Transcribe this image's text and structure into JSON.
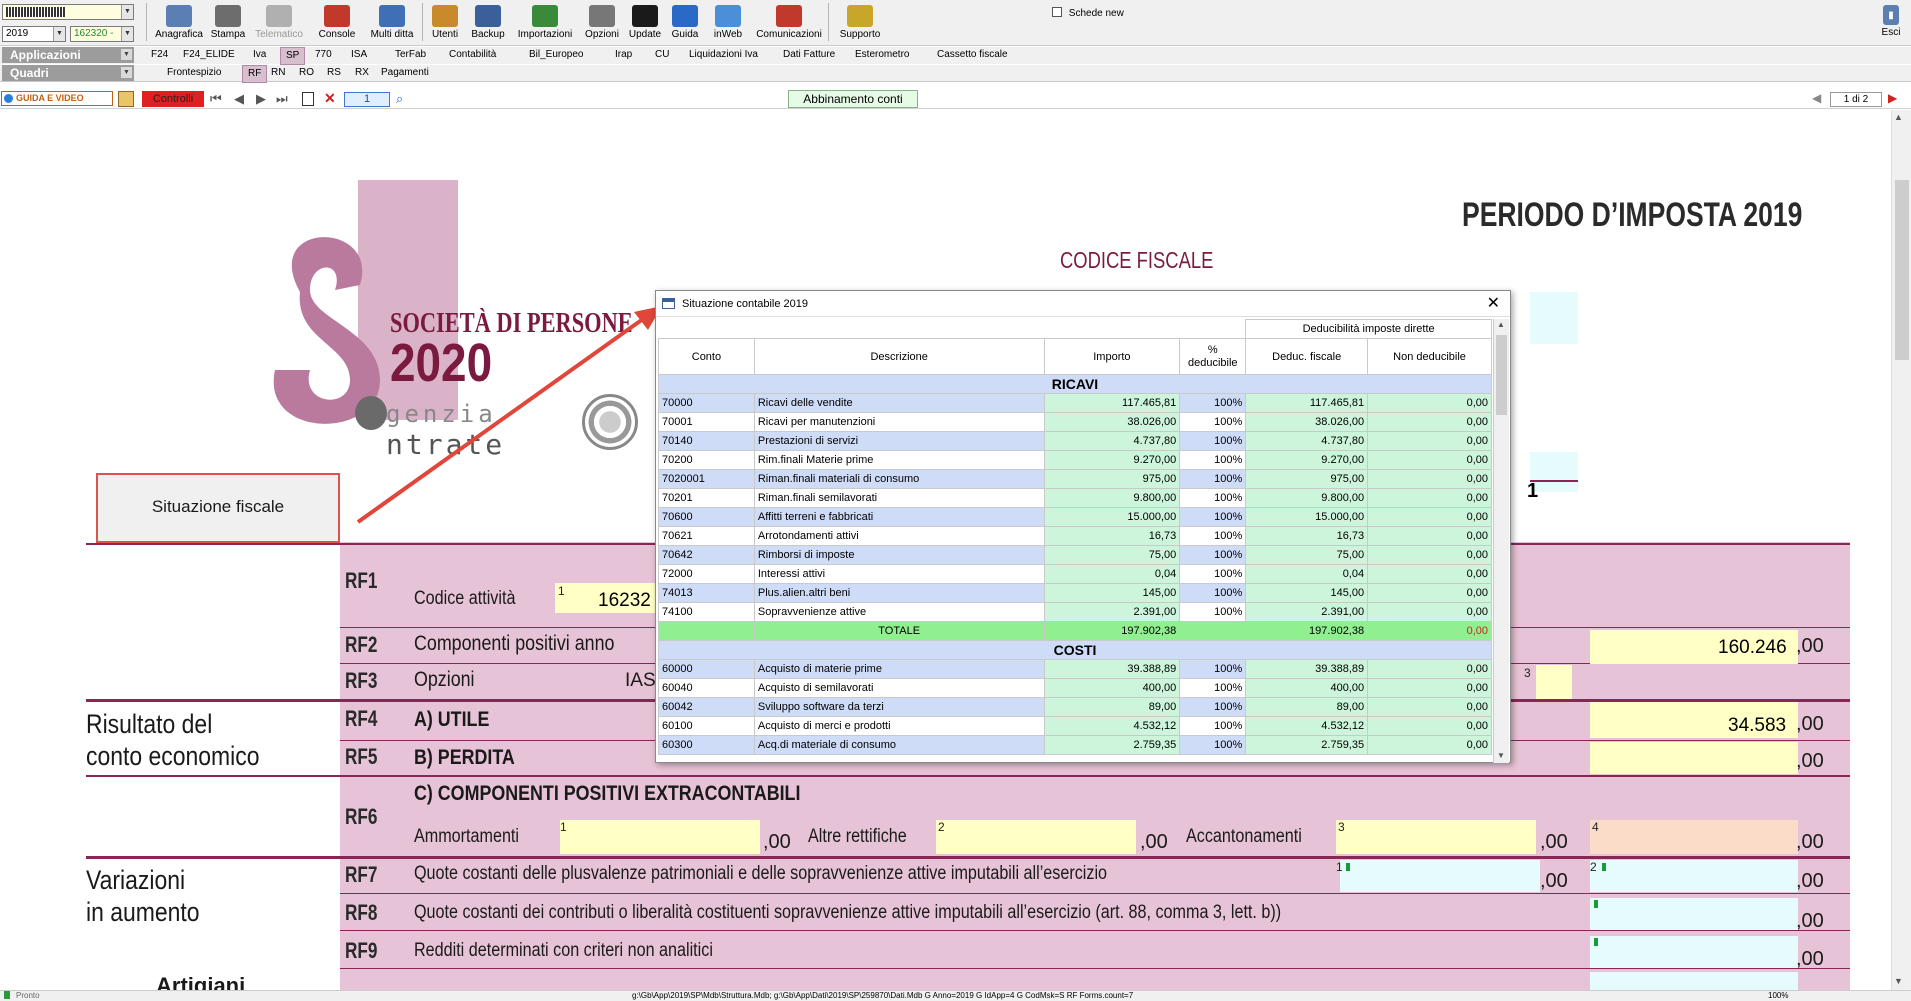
{
  "top": {
    "year": "2019",
    "code": "162320 -",
    "applicazioni": "Applicazioni",
    "quadri": "Quadri",
    "schede_new": "Schede new",
    "esci": "Esci"
  },
  "toolbar": [
    {
      "label": "Anagrafica",
      "icon": "anagrafica-icon",
      "color": "#5b7fb4"
    },
    {
      "label": "Stampa",
      "icon": "printer-icon",
      "color": "#6d6d6d"
    },
    {
      "label": "Telematico",
      "icon": "telematico-icon",
      "color": "#b0b0b0"
    },
    {
      "label": "Console",
      "icon": "console-icon",
      "color": "#c0392b"
    },
    {
      "label": "Multi ditta",
      "icon": "multi-ditta-icon",
      "color": "#3f6fb5"
    },
    {
      "label": "Utenti",
      "icon": "users-icon",
      "color": "#c98a2b"
    },
    {
      "label": "Backup",
      "icon": "backup-icon",
      "color": "#3b5f9a"
    },
    {
      "label": "Importazioni",
      "icon": "import-icon",
      "color": "#3a8a3a"
    },
    {
      "label": "Opzioni",
      "icon": "options-icon",
      "color": "#777"
    },
    {
      "label": "Update",
      "icon": "update-icon",
      "color": "#1a1a1a"
    },
    {
      "label": "Guida",
      "icon": "help-icon",
      "color": "#2a69c6"
    },
    {
      "label": "inWeb",
      "icon": "cloud-icon",
      "color": "#4a90d9"
    },
    {
      "label": "Comunicazioni",
      "icon": "comunicazioni-icon",
      "color": "#c0392b"
    },
    {
      "label": "Supporto",
      "icon": "support-icon",
      "color": "#c8a62a"
    }
  ],
  "apps_menu": [
    "F24",
    "F24_ELIDE",
    "Iva",
    "SP",
    "770",
    "ISA",
    "TerFab",
    "Contabilità",
    "Bil_Europeo",
    "Irap",
    "CU",
    "Liquidazioni Iva",
    "Dati Fatture",
    "Esterometro",
    "Cassetto fiscale"
  ],
  "quadri_menu": [
    "Frontespizio",
    "RF",
    "RN",
    "RO",
    "RS",
    "RX",
    "Pagamenti"
  ],
  "nav": {
    "guida_video": "GUIDA E VIDEO",
    "controlli": "Controlli",
    "page_field": "1",
    "abbinamento": "Abbinamento conti",
    "page_of": "1 di 2"
  },
  "form": {
    "periodo": "PERIODO D’IMPOSTA 2019",
    "codice_fiscale": "CODICE FISCALE",
    "logo_line1": "SOCIETÀ DI PERSONE",
    "logo_line2": "2020",
    "agenzia1": "genzia",
    "agenzia2": "ntrate",
    "sit_fiscale_button": "Situazione fiscale",
    "modulo_number": "1",
    "risultato_label": "Risultato del\nconto economico",
    "variazioni_label": "Variazioni\nin aumento",
    "artigiani_label": "Artigiani",
    "rows": [
      {
        "code": "RF1",
        "text": "Codice attività",
        "value": "16232"
      },
      {
        "code": "RF2",
        "text": "Componenti positivi anno",
        "value": "160.246"
      },
      {
        "code": "RF3",
        "text": "Opzioni",
        "ias": "IAS"
      },
      {
        "code": "RF4",
        "text": "A) UTILE",
        "value": "34.583"
      },
      {
        "code": "RF5",
        "text": "B) PERDITA",
        "value": ""
      },
      {
        "code": "RF6",
        "text": "C) COMPONENTI POSITIVI EXTRACONTABILI"
      },
      {
        "code": "RF7",
        "text": "Quote costanti delle plusvalenze patrimoniali e delle sopravvenienze attive imputabili all’esercizio"
      },
      {
        "code": "RF8",
        "text": "Quote costanti dei contributi o liberalità costituenti sopravvenienze attive imputabili all’esercizio (art. 88, comma 3, lett. b))"
      },
      {
        "code": "RF9",
        "text": "Redditi determinati con criteri non analitici"
      }
    ],
    "rf6_fields": [
      "Ammortamenti",
      "Altre rettifiche",
      "Accantonamenti"
    ],
    "zeros": ",00"
  },
  "dialog": {
    "title": "Situazione contabile 2019",
    "headers": {
      "group": "Deducibilità imposte dirette",
      "conto": "Conto",
      "descrizione": "Descrizione",
      "importo": "Importo",
      "perc": "% deducibile",
      "deduc": "Deduc. fiscale",
      "non": "Non deducibile"
    },
    "ricavi_title": "RICAVI",
    "ricavi": [
      {
        "conto": "70000",
        "descr": "Ricavi delle vendite",
        "importo": "117.465,81",
        "perc": "100%",
        "deduc": "117.465,81",
        "non": "0,00"
      },
      {
        "conto": "70001",
        "descr": "Ricavi per manutenzioni",
        "importo": "38.026,00",
        "perc": "100%",
        "deduc": "38.026,00",
        "non": "0,00"
      },
      {
        "conto": "70140",
        "descr": "Prestazioni di servizi",
        "importo": "4.737,80",
        "perc": "100%",
        "deduc": "4.737,80",
        "non": "0,00"
      },
      {
        "conto": "70200",
        "descr": "Rim.finali Materie prime",
        "importo": "9.270,00",
        "perc": "100%",
        "deduc": "9.270,00",
        "non": "0,00"
      },
      {
        "conto": "7020001",
        "descr": "Riman.finali materiali di consumo",
        "importo": "975,00",
        "perc": "100%",
        "deduc": "975,00",
        "non": "0,00"
      },
      {
        "conto": "70201",
        "descr": "Riman.finali semilavorati",
        "importo": "9.800,00",
        "perc": "100%",
        "deduc": "9.800,00",
        "non": "0,00"
      },
      {
        "conto": "70600",
        "descr": "Affitti terreni e fabbricati",
        "importo": "15.000,00",
        "perc": "100%",
        "deduc": "15.000,00",
        "non": "0,00"
      },
      {
        "conto": "70621",
        "descr": "Arrotondamenti attivi",
        "importo": "16,73",
        "perc": "100%",
        "deduc": "16,73",
        "non": "0,00"
      },
      {
        "conto": "70642",
        "descr": "Rimborsi di imposte",
        "importo": "75,00",
        "perc": "100%",
        "deduc": "75,00",
        "non": "0,00"
      },
      {
        "conto": "72000",
        "descr": "Interessi attivi",
        "importo": "0,04",
        "perc": "100%",
        "deduc": "0,04",
        "non": "0,00"
      },
      {
        "conto": "74013",
        "descr": "Plus.alien.altri beni",
        "importo": "145,00",
        "perc": "100%",
        "deduc": "145,00",
        "non": "0,00"
      },
      {
        "conto": "74100",
        "descr": "Sopravvenienze attive",
        "importo": "2.391,00",
        "perc": "100%",
        "deduc": "2.391,00",
        "non": "0,00"
      }
    ],
    "totale": {
      "label": "TOTALE",
      "importo": "197.902,38",
      "deduc": "197.902,38",
      "non": "0,00"
    },
    "costi_title": "COSTI",
    "costi": [
      {
        "conto": "60000",
        "descr": "Acquisto di materie prime",
        "importo": "39.388,89",
        "perc": "100%",
        "deduc": "39.388,89",
        "non": "0,00"
      },
      {
        "conto": "60040",
        "descr": "Acquisto di semilavorati",
        "importo": "400,00",
        "perc": "100%",
        "deduc": "400,00",
        "non": "0,00"
      },
      {
        "conto": "60042",
        "descr": "Sviluppo software da terzi",
        "importo": "89,00",
        "perc": "100%",
        "deduc": "89,00",
        "non": "0,00"
      },
      {
        "conto": "60100",
        "descr": "Acquisto di merci e prodotti",
        "importo": "4.532,12",
        "perc": "100%",
        "deduc": "4.532,12",
        "non": "0,00"
      },
      {
        "conto": "60300",
        "descr": "Acq.di materiale di consumo",
        "importo": "2.759,35",
        "perc": "100%",
        "deduc": "2.759,35",
        "non": "0,00"
      }
    ]
  },
  "status": {
    "left": "Pronto",
    "path": "g:\\Gb\\App\\2019\\SP\\Mdb\\Struttura.Mdb; g:\\Gb\\App\\Dati\\2019\\SP\\259870\\Dati.Mdb G  Anno=2019 G  IdApp=4 G  CodMsk=S  RF Forms.count=7",
    "zoom": "100%"
  },
  "colors": {
    "maroon": "#8a2556",
    "pink": "#e6c3d6",
    "yellow": "#ffffc6",
    "cyan": "#e6fbfb",
    "blueRow": "#cfdcf7",
    "greenCell": "#cdf5dc",
    "arrow": "#e0463a"
  }
}
